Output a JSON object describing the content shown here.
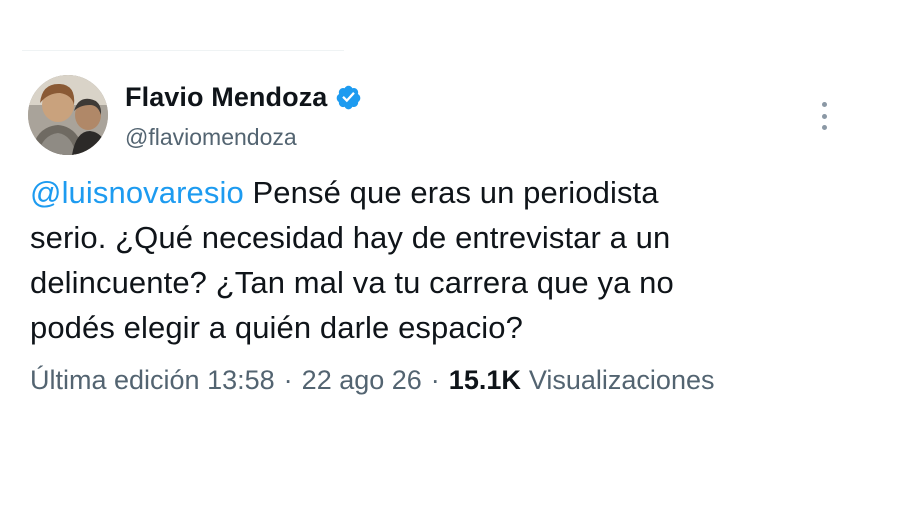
{
  "tweet": {
    "author": {
      "name": "Flavio Mendoza",
      "handle": "@flaviomendoza",
      "verified": true,
      "avatar_icon": "avatar-photo"
    },
    "mention": "@luisnovaresio",
    "text_lines": [
      " Pensé que eras un periodista",
      "serio. ¿Qué necesidad hay de entrevistar a un",
      "delincuente? ¿Tan mal va tu carrera que ya no",
      "podés elegir a quién darle espacio?"
    ],
    "meta": {
      "edited_label": "Última edición",
      "time": "13:58",
      "separator": "·",
      "date": "22 ago 26",
      "views_count": "15.1K",
      "views_label": "Visualizaciones"
    }
  },
  "icons": {
    "verified": "verified-badge-icon",
    "more": "more-options-icon"
  },
  "colors": {
    "text_primary": "#0f1419",
    "text_secondary": "#536471",
    "accent": "#1d9bf0"
  }
}
